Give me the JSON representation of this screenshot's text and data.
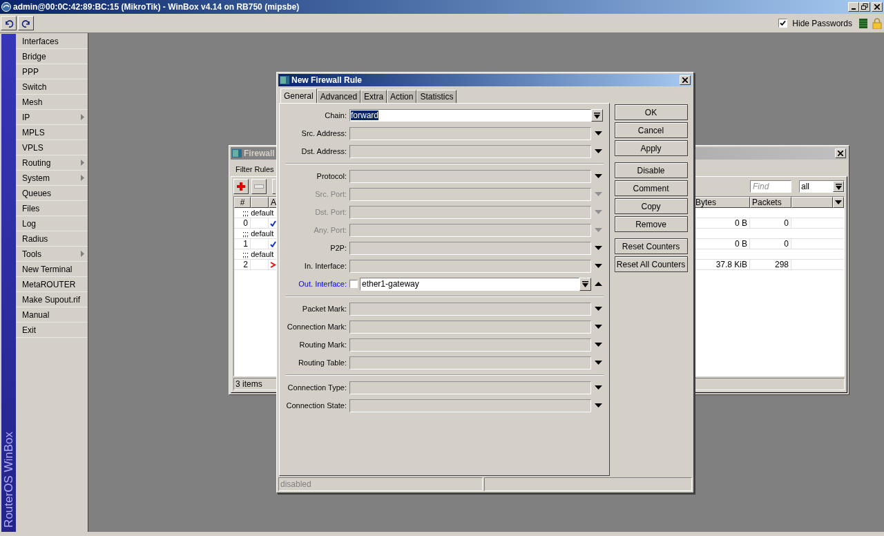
{
  "window": {
    "title": "admin@00:0C:42:89:BC:15 (MikroTik) - WinBox v4.14 on RB750 (mipsbe)"
  },
  "toolbar": {
    "hide_passwords": {
      "label": "Hide Passwords",
      "checked": true
    }
  },
  "sidebar": {
    "brand": "RouterOS WinBox",
    "items": [
      {
        "label": "Interfaces",
        "submenu": false
      },
      {
        "label": "Bridge",
        "submenu": false
      },
      {
        "label": "PPP",
        "submenu": false
      },
      {
        "label": "Switch",
        "submenu": false
      },
      {
        "label": "Mesh",
        "submenu": false
      },
      {
        "label": "IP",
        "submenu": true
      },
      {
        "label": "MPLS",
        "submenu": false
      },
      {
        "label": "VPLS",
        "submenu": false
      },
      {
        "label": "Routing",
        "submenu": true
      },
      {
        "label": "System",
        "submenu": true
      },
      {
        "label": "Queues",
        "submenu": false
      },
      {
        "label": "Files",
        "submenu": false
      },
      {
        "label": "Log",
        "submenu": false
      },
      {
        "label": "Radius",
        "submenu": false
      },
      {
        "label": "Tools",
        "submenu": true
      },
      {
        "label": "New Terminal",
        "submenu": false
      },
      {
        "label": "MetaROUTER",
        "submenu": false
      },
      {
        "label": "Make Supout.rif",
        "submenu": false
      },
      {
        "label": "Manual",
        "submenu": false
      },
      {
        "label": "Exit",
        "submenu": false
      }
    ]
  },
  "firewall_window": {
    "title": "Firewall",
    "tabs": [
      {
        "label": "Filter Rules",
        "selected": true
      }
    ],
    "find": {
      "placeholder": "Find"
    },
    "filter": {
      "value": "all"
    },
    "columns": [
      {
        "label": "#"
      },
      {
        "label": "A"
      },
      {
        "label": "Bytes"
      },
      {
        "label": "Packets"
      }
    ],
    "rows": [
      {
        "kind": "comment",
        "text": ";;; default"
      },
      {
        "kind": "accept",
        "number": "0",
        "bytes": "0 B",
        "packets": "0"
      },
      {
        "kind": "comment",
        "text": ";;; default"
      },
      {
        "kind": "accept",
        "number": "1",
        "bytes": "0 B",
        "packets": "0"
      },
      {
        "kind": "comment",
        "text": ";;; default"
      },
      {
        "kind": "drop",
        "number": "2",
        "bytes": "37.8 KiB",
        "packets": "298"
      }
    ],
    "status": "3 items"
  },
  "dialog": {
    "title": "New Firewall Rule",
    "tabs": [
      {
        "label": "General",
        "selected": true
      },
      {
        "label": "Advanced",
        "selected": false
      },
      {
        "label": "Extra",
        "selected": false
      },
      {
        "label": "Action",
        "selected": false
      },
      {
        "label": "Statistics",
        "selected": false
      }
    ],
    "groups": [
      [
        {
          "label": "Chain:",
          "kind": "select",
          "value": "forward"
        },
        {
          "label": "Src. Address:",
          "kind": "collapsed",
          "disabled": false
        },
        {
          "label": "Dst. Address:",
          "kind": "collapsed",
          "disabled": false
        }
      ],
      [
        {
          "label": "Protocol:",
          "kind": "collapsed",
          "disabled": false
        },
        {
          "label": "Src. Port:",
          "kind": "collapsed",
          "disabled": true
        },
        {
          "label": "Dst. Port:",
          "kind": "collapsed",
          "disabled": true
        },
        {
          "label": "Any. Port:",
          "kind": "collapsed",
          "disabled": true
        },
        {
          "label": "P2P:",
          "kind": "collapsed",
          "disabled": false
        },
        {
          "label": "In. Interface:",
          "kind": "collapsed",
          "disabled": false
        },
        {
          "label": "Out. Interface:",
          "kind": "expanded",
          "negate": false,
          "value": "ether1-gateway"
        }
      ],
      [
        {
          "label": "Packet Mark:",
          "kind": "collapsed",
          "disabled": false
        },
        {
          "label": "Connection Mark:",
          "kind": "collapsed",
          "disabled": false
        },
        {
          "label": "Routing Mark:",
          "kind": "collapsed",
          "disabled": false
        },
        {
          "label": "Routing Table:",
          "kind": "collapsed",
          "disabled": false
        }
      ],
      [
        {
          "label": "Connection Type:",
          "kind": "collapsed",
          "disabled": false
        },
        {
          "label": "Connection State:",
          "kind": "collapsed",
          "disabled": false
        }
      ]
    ],
    "button_groups": [
      [
        "OK",
        "Cancel",
        "Apply"
      ],
      [
        "Disable",
        "Comment",
        "Copy",
        "Remove"
      ],
      [
        "Reset Counters",
        "Reset All Counters"
      ]
    ],
    "status": "disabled"
  }
}
